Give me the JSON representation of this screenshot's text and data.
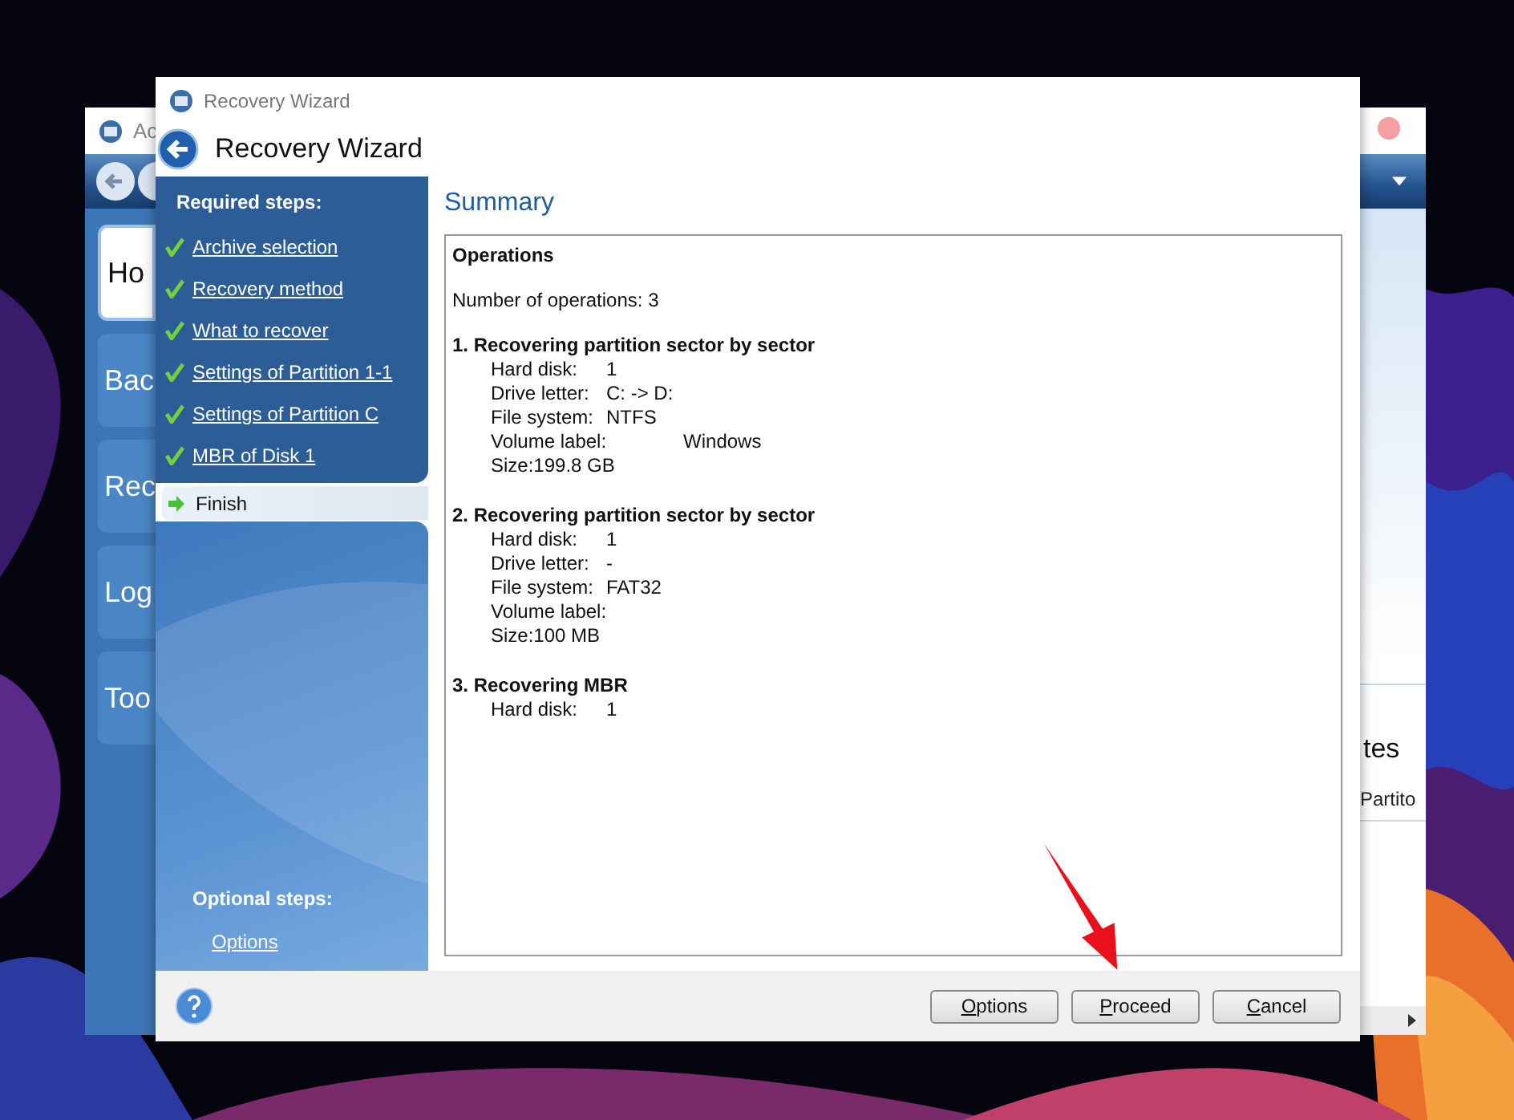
{
  "background_window": {
    "title": "Ac",
    "nav_tiles": [
      "Ho",
      "Bac",
      "Rec",
      "Log",
      "Too"
    ],
    "section_heading": "tes",
    "list_item": "Partito"
  },
  "window": {
    "title": "Recovery Wizard",
    "header": "Recovery Wizard"
  },
  "sidebar": {
    "required_heading": "Required steps:",
    "steps": [
      {
        "label": "Archive selection",
        "selected": false
      },
      {
        "label": "Recovery method",
        "selected": false
      },
      {
        "label": "What to recover",
        "selected": false
      },
      {
        "label": "Settings of Partition 1-1",
        "selected": false
      },
      {
        "label": "Settings of Partition C",
        "selected": false
      },
      {
        "label": "MBR of Disk 1",
        "selected": false
      },
      {
        "label": "Finish",
        "selected": true
      }
    ],
    "optional_heading": "Optional steps:",
    "optional_items": [
      "Options"
    ]
  },
  "summary": {
    "title": "Summary",
    "heading": "Operations",
    "count_line": "Number of operations: 3",
    "operations": [
      {
        "title": "1. Recovering partition sector by sector",
        "lines": [
          {
            "kind": "pair",
            "parts": [
              "Hard disk:",
              "1"
            ]
          },
          {
            "kind": "pair",
            "parts": [
              "Drive letter:",
              "C: -> D:"
            ]
          },
          {
            "kind": "pair",
            "parts": [
              "File system:",
              "NTFS"
            ]
          },
          {
            "kind": "wide",
            "parts": [
              "Volume label:",
              "Windows"
            ]
          },
          {
            "kind": "line",
            "parts": [
              "Size:",
              "199.8 GB"
            ]
          }
        ]
      },
      {
        "title": "2. Recovering partition sector by sector",
        "lines": [
          {
            "kind": "pair",
            "parts": [
              "Hard disk:",
              "1"
            ]
          },
          {
            "kind": "pair",
            "parts": [
              "Drive letter:",
              "-"
            ]
          },
          {
            "kind": "pair",
            "parts": [
              "File system:",
              "FAT32"
            ]
          },
          {
            "kind": "pair",
            "parts": [
              "Volume label:"
            ]
          },
          {
            "kind": "line",
            "parts": [
              "Size:",
              "100 MB"
            ]
          }
        ]
      },
      {
        "title": "3. Recovering MBR",
        "lines": [
          {
            "kind": "pair",
            "parts": [
              "Hard disk:",
              "1"
            ]
          }
        ]
      }
    ]
  },
  "buttons": [
    {
      "label": "Options"
    },
    {
      "label": "Proceed"
    },
    {
      "label": "Cancel"
    }
  ]
}
